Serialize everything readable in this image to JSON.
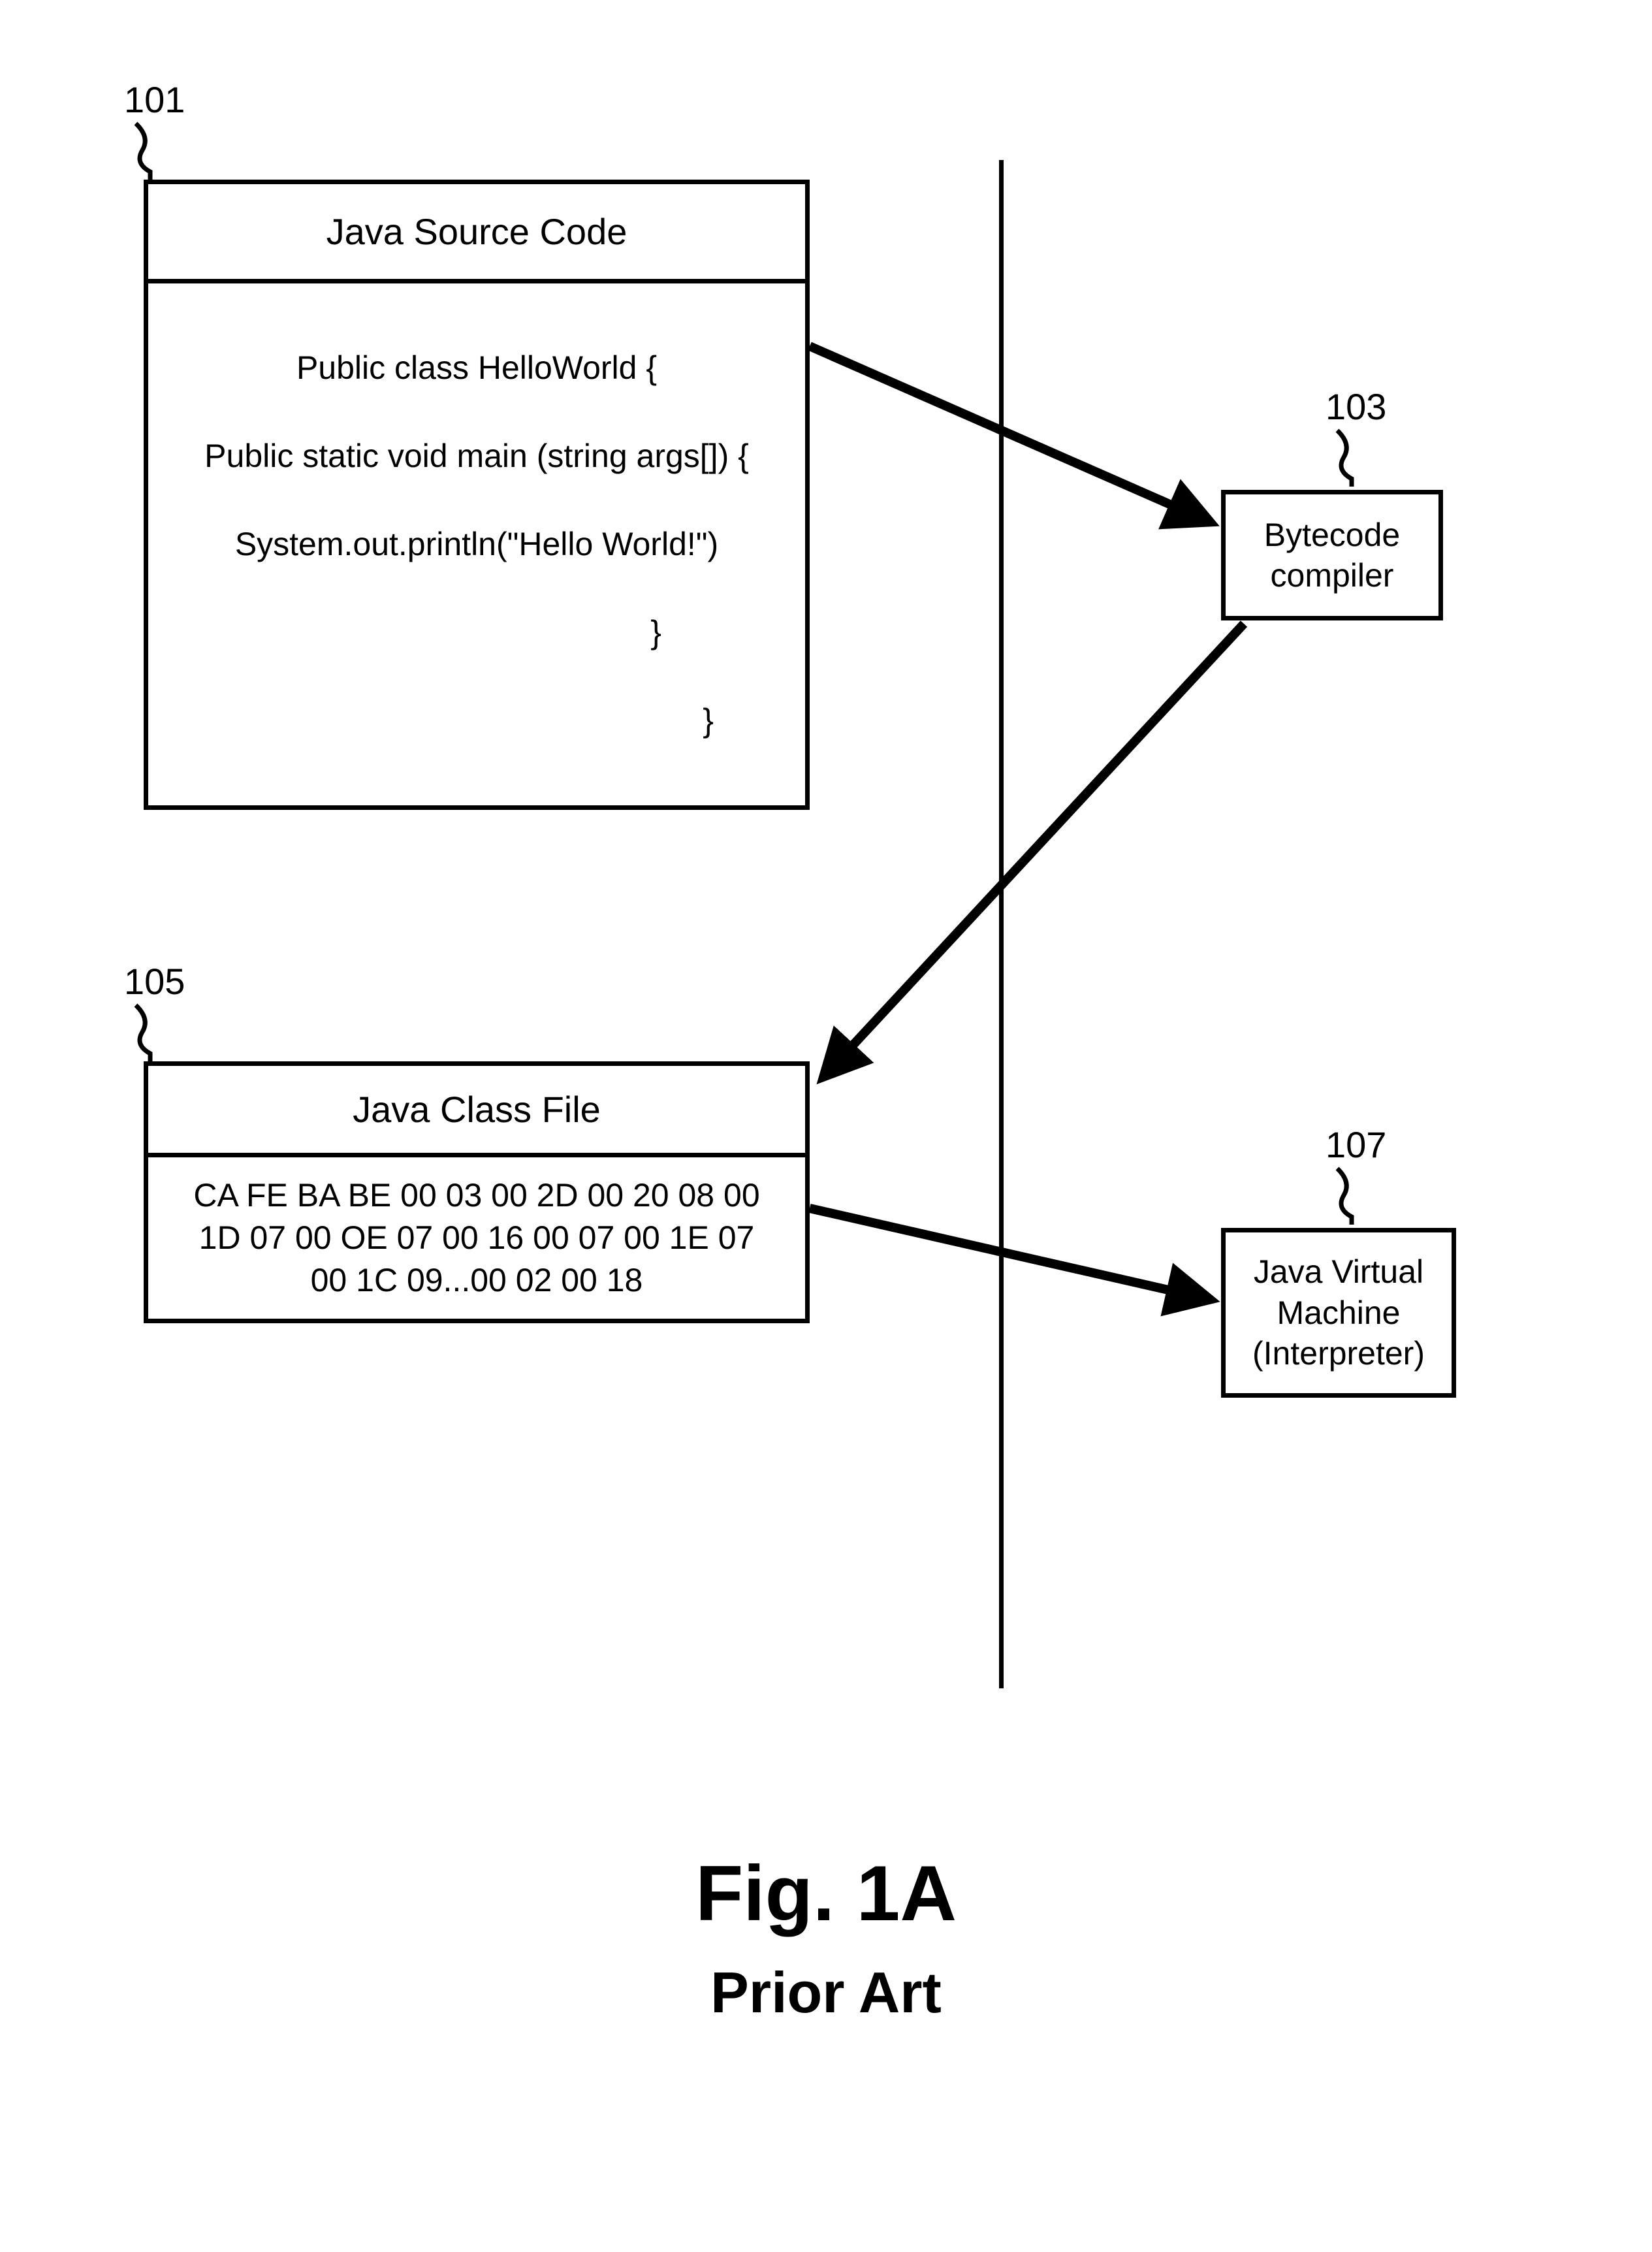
{
  "refs": {
    "source": "101",
    "compiler": "103",
    "classfile": "105",
    "jvm": "107"
  },
  "source_box": {
    "title": "Java Source Code",
    "code_l1": "Public class HelloWorld {",
    "code_l2": "Public static void main (string args[]) {",
    "code_l3": "System.out.println(\"Hello World!\")",
    "code_l4": "}",
    "code_l5": "}"
  },
  "compiler_box": {
    "line1": "Bytecode",
    "line2": "compiler"
  },
  "class_box": {
    "title": "Java Class File",
    "hex_l1": "CA FE BA BE 00 03 00 2D 00 20 08 00",
    "hex_l2": "1D 07 00 OE 07 00 16 00 07 00 1E 07",
    "hex_l3": "00 1C 09...00 02 00 18"
  },
  "jvm_box": {
    "line1": "Java Virtual",
    "line2": "Machine",
    "line3": "(Interpreter)"
  },
  "figure": {
    "main": "Fig. 1A",
    "sub": "Prior Art"
  }
}
